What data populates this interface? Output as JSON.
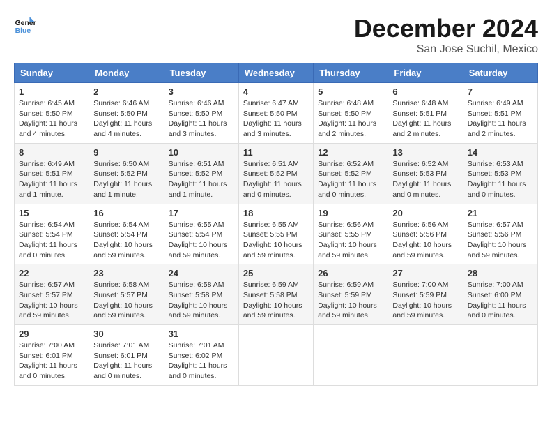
{
  "header": {
    "logo_line1": "General",
    "logo_line2": "Blue",
    "month_title": "December 2024",
    "location": "San Jose Suchil, Mexico"
  },
  "days_of_week": [
    "Sunday",
    "Monday",
    "Tuesday",
    "Wednesday",
    "Thursday",
    "Friday",
    "Saturday"
  ],
  "weeks": [
    [
      {
        "day": "1",
        "sunrise": "6:45 AM",
        "sunset": "5:50 PM",
        "daylight": "11 hours and 4 minutes."
      },
      {
        "day": "2",
        "sunrise": "6:46 AM",
        "sunset": "5:50 PM",
        "daylight": "11 hours and 4 minutes."
      },
      {
        "day": "3",
        "sunrise": "6:46 AM",
        "sunset": "5:50 PM",
        "daylight": "11 hours and 3 minutes."
      },
      {
        "day": "4",
        "sunrise": "6:47 AM",
        "sunset": "5:50 PM",
        "daylight": "11 hours and 3 minutes."
      },
      {
        "day": "5",
        "sunrise": "6:48 AM",
        "sunset": "5:50 PM",
        "daylight": "11 hours and 2 minutes."
      },
      {
        "day": "6",
        "sunrise": "6:48 AM",
        "sunset": "5:51 PM",
        "daylight": "11 hours and 2 minutes."
      },
      {
        "day": "7",
        "sunrise": "6:49 AM",
        "sunset": "5:51 PM",
        "daylight": "11 hours and 2 minutes."
      }
    ],
    [
      {
        "day": "8",
        "sunrise": "6:49 AM",
        "sunset": "5:51 PM",
        "daylight": "11 hours and 1 minute."
      },
      {
        "day": "9",
        "sunrise": "6:50 AM",
        "sunset": "5:52 PM",
        "daylight": "11 hours and 1 minute."
      },
      {
        "day": "10",
        "sunrise": "6:51 AM",
        "sunset": "5:52 PM",
        "daylight": "11 hours and 1 minute."
      },
      {
        "day": "11",
        "sunrise": "6:51 AM",
        "sunset": "5:52 PM",
        "daylight": "11 hours and 0 minutes."
      },
      {
        "day": "12",
        "sunrise": "6:52 AM",
        "sunset": "5:52 PM",
        "daylight": "11 hours and 0 minutes."
      },
      {
        "day": "13",
        "sunrise": "6:52 AM",
        "sunset": "5:53 PM",
        "daylight": "11 hours and 0 minutes."
      },
      {
        "day": "14",
        "sunrise": "6:53 AM",
        "sunset": "5:53 PM",
        "daylight": "11 hours and 0 minutes."
      }
    ],
    [
      {
        "day": "15",
        "sunrise": "6:54 AM",
        "sunset": "5:54 PM",
        "daylight": "11 hours and 0 minutes."
      },
      {
        "day": "16",
        "sunrise": "6:54 AM",
        "sunset": "5:54 PM",
        "daylight": "10 hours and 59 minutes."
      },
      {
        "day": "17",
        "sunrise": "6:55 AM",
        "sunset": "5:54 PM",
        "daylight": "10 hours and 59 minutes."
      },
      {
        "day": "18",
        "sunrise": "6:55 AM",
        "sunset": "5:55 PM",
        "daylight": "10 hours and 59 minutes."
      },
      {
        "day": "19",
        "sunrise": "6:56 AM",
        "sunset": "5:55 PM",
        "daylight": "10 hours and 59 minutes."
      },
      {
        "day": "20",
        "sunrise": "6:56 AM",
        "sunset": "5:56 PM",
        "daylight": "10 hours and 59 minutes."
      },
      {
        "day": "21",
        "sunrise": "6:57 AM",
        "sunset": "5:56 PM",
        "daylight": "10 hours and 59 minutes."
      }
    ],
    [
      {
        "day": "22",
        "sunrise": "6:57 AM",
        "sunset": "5:57 PM",
        "daylight": "10 hours and 59 minutes."
      },
      {
        "day": "23",
        "sunrise": "6:58 AM",
        "sunset": "5:57 PM",
        "daylight": "10 hours and 59 minutes."
      },
      {
        "day": "24",
        "sunrise": "6:58 AM",
        "sunset": "5:58 PM",
        "daylight": "10 hours and 59 minutes."
      },
      {
        "day": "25",
        "sunrise": "6:59 AM",
        "sunset": "5:58 PM",
        "daylight": "10 hours and 59 minutes."
      },
      {
        "day": "26",
        "sunrise": "6:59 AM",
        "sunset": "5:59 PM",
        "daylight": "10 hours and 59 minutes."
      },
      {
        "day": "27",
        "sunrise": "7:00 AM",
        "sunset": "5:59 PM",
        "daylight": "10 hours and 59 minutes."
      },
      {
        "day": "28",
        "sunrise": "7:00 AM",
        "sunset": "6:00 PM",
        "daylight": "11 hours and 0 minutes."
      }
    ],
    [
      {
        "day": "29",
        "sunrise": "7:00 AM",
        "sunset": "6:01 PM",
        "daylight": "11 hours and 0 minutes."
      },
      {
        "day": "30",
        "sunrise": "7:01 AM",
        "sunset": "6:01 PM",
        "daylight": "11 hours and 0 minutes."
      },
      {
        "day": "31",
        "sunrise": "7:01 AM",
        "sunset": "6:02 PM",
        "daylight": "11 hours and 0 minutes."
      },
      null,
      null,
      null,
      null
    ]
  ],
  "labels": {
    "sunrise": "Sunrise:",
    "sunset": "Sunset:",
    "daylight": "Daylight:"
  }
}
